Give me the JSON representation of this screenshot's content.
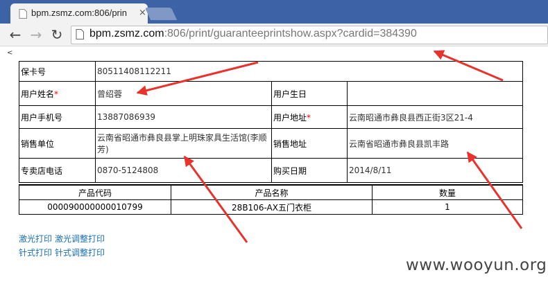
{
  "tab": {
    "title": "bpm.zsmz.com:806/prin",
    "close": "×"
  },
  "address_bar": {
    "host": "bpm.zsmz.com",
    "rest": ":806/print/guaranteeprintshow.aspx?cardid=384390"
  },
  "page": {
    "stray_char": "<",
    "info": {
      "card_no_label": "保卡号",
      "card_no": "80511408112211",
      "user_name_label": "用户姓名",
      "user_name": "曾绍蓉",
      "birthday_label": "用户生日",
      "birthday": "",
      "phone_label": "用户手机号",
      "phone": "13887086939",
      "address_label": "用户地址",
      "address": "云南昭通市彝良县西正街3区21-4",
      "sales_unit_label": "销售单位",
      "sales_unit": "云南省昭通市彝良县掌上明珠家具生活馆(李顺芳)",
      "sales_address_label": "销售地址",
      "sales_address": "云南省昭通市彝良县凯丰路",
      "store_phone_label": "专卖店电话",
      "store_phone": "0870-5124808",
      "purchase_date_label": "购买日期",
      "purchase_date": "2014/8/11",
      "required_mark": "*"
    },
    "products": {
      "headers": [
        "产品代码",
        "产品名称",
        "数量"
      ],
      "rows": [
        [
          "000090000000010799",
          "28B106-AX五门衣柜",
          "1"
        ]
      ]
    },
    "links": {
      "laser_print": "激光打印",
      "laser_adjust": "激光调整打印",
      "needle_print": "针式打印",
      "needle_adjust": "针式调整打印"
    }
  },
  "watermark": "www.wooyun.org",
  "colors": {
    "tabbar": "#3d62a6",
    "arrow": "#e8322b",
    "link": "#1a6fb5"
  }
}
